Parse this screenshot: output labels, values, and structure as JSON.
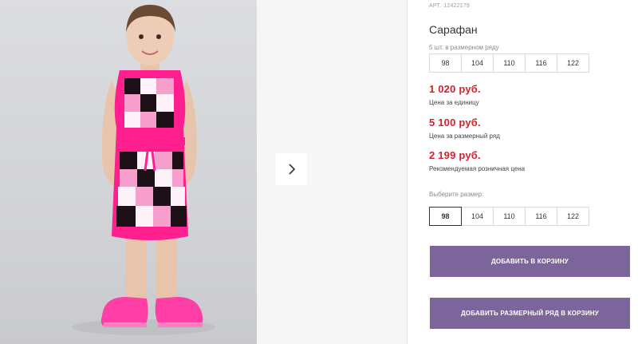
{
  "product": {
    "article_label": "АРТ.",
    "article_number": "12422179",
    "title": "Сарафан",
    "row_note": "5 шт. в размерном ряду",
    "row_sizes": [
      "98",
      "104",
      "110",
      "116",
      "122"
    ]
  },
  "prices": [
    {
      "value": "1 020 руб.",
      "label": "Цена за единицу"
    },
    {
      "value": "5 100 руб.",
      "label": "Цена за размерный ряд"
    },
    {
      "value": "2 199 руб.",
      "label": "Рекомендуемая розничная цена"
    }
  ],
  "size_picker": {
    "label": "Выберите размер:",
    "sizes": [
      "98",
      "104",
      "110",
      "116",
      "122"
    ],
    "selected": "98"
  },
  "buttons": {
    "add_to_cart": "ДОБАВИТЬ В КОРЗИНУ",
    "add_row_to_cart": "ДОБАВИТЬ РАЗМЕРНЫЙ РЯД В КОРЗИНУ"
  },
  "gallery": {
    "next_icon": "chevron-right-icon",
    "photo_description_icon": "product-photo"
  },
  "colors": {
    "accent_button": "#7b659b",
    "price_red": "#d6212c",
    "dress_pink": "#ff1f8f",
    "shoe_pink": "#ff3fa6"
  }
}
